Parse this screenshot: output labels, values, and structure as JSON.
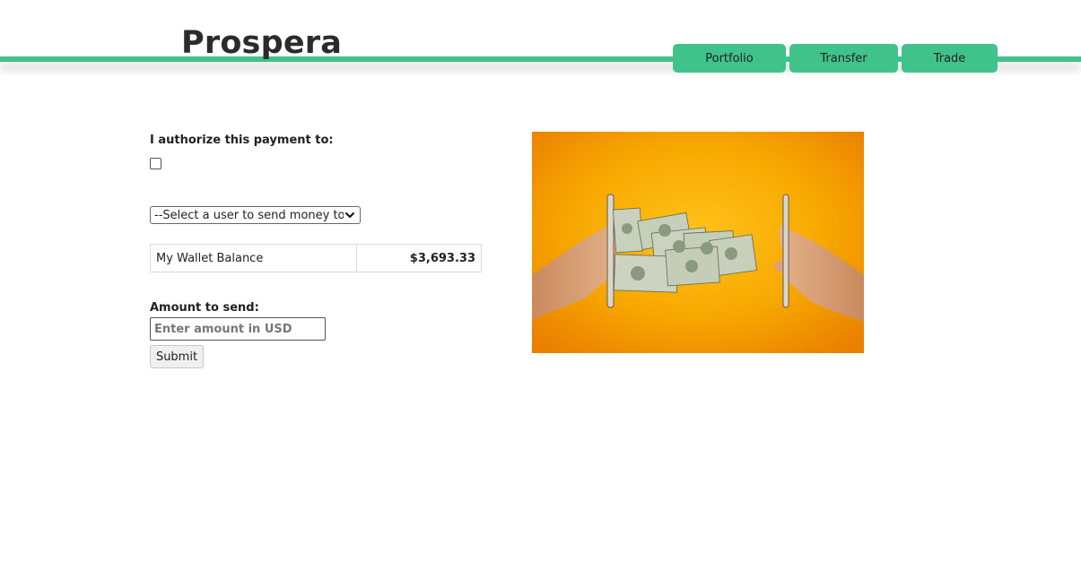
{
  "header": {
    "brand": "Prospera",
    "nav": [
      {
        "label": "Portfolio"
      },
      {
        "label": "Transfer"
      },
      {
        "label": "Trade"
      }
    ],
    "accent_color": "#40c28b"
  },
  "form": {
    "authorize_label": "I authorize this payment to:",
    "authorize_checked": false,
    "recipient_select": {
      "selected": "--Select a user to send money to--"
    },
    "wallet": {
      "label": "My Wallet Balance",
      "value": "$3,693.33"
    },
    "amount_label": "Amount to send:",
    "amount_input": {
      "placeholder": "Enter amount in USD",
      "value": ""
    },
    "submit_label": "Submit"
  },
  "hero": {
    "image_subject": "hands-with-phones-passing-dollar-bills",
    "background_color": "#f5a300"
  }
}
